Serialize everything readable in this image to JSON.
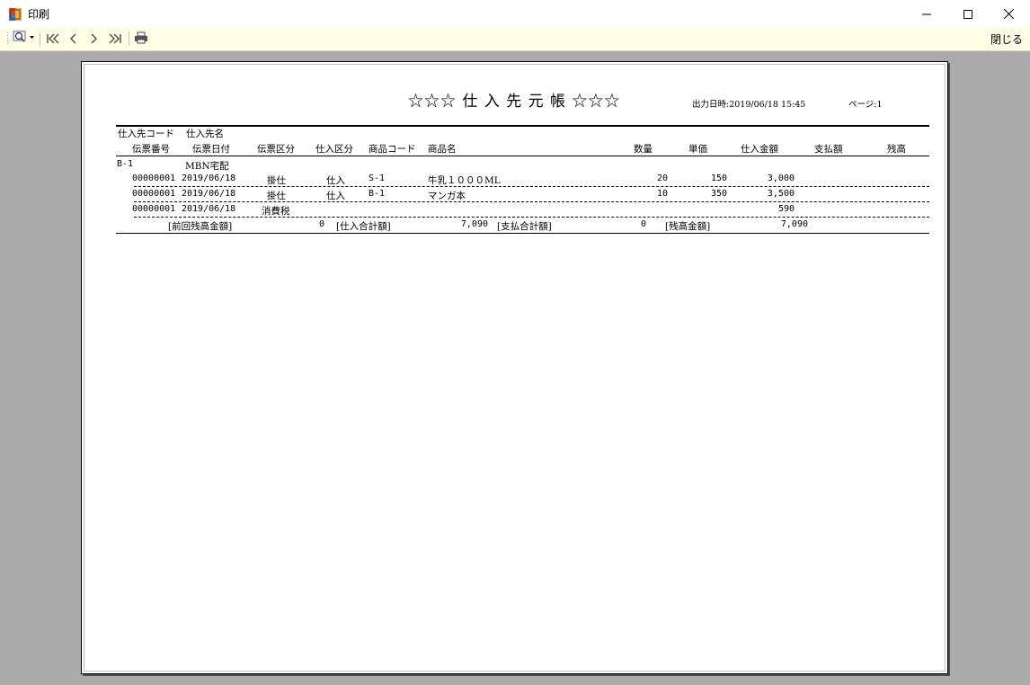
{
  "window": {
    "title": "印刷",
    "minimize_icon": "minimize-icon",
    "maximize_icon": "maximize-icon",
    "close_icon": "close-icon"
  },
  "toolbar": {
    "zoom_icon": "zoom-icon",
    "first_icon": "first-page-icon",
    "prev_icon": "previous-page-icon",
    "next_icon": "next-page-icon",
    "last_icon": "last-page-icon",
    "print_icon": "printer-icon",
    "close_label": "閉じる"
  },
  "report": {
    "title": "☆☆☆ 仕 入 先 元 帳 ☆☆☆",
    "output_datetime": "出力日時:2019/06/18 15:45",
    "page_label": "ページ:1",
    "header1": {
      "supplier_code": "仕入先コード",
      "supplier_name": "仕入先名"
    },
    "header2": {
      "slip_no": "伝票番号",
      "slip_date": "伝票日付",
      "slip_type": "伝票区分",
      "purchase_type": "仕入区分",
      "product_code": "商品コード",
      "product_name": "商品名",
      "quantity": "数量",
      "unit_price": "単価",
      "purchase_amount": "仕入金額",
      "payment_amount": "支払額",
      "balance": "残高"
    },
    "supplier": {
      "code": "B-1",
      "name": "MBN宅配"
    },
    "rows": [
      {
        "slip_no": "00000001",
        "date": "2019/06/18",
        "slip_type": "掛仕",
        "purchase_type": "仕入",
        "product_code": "S-1",
        "product_name": "牛乳１０００ML",
        "qty": "20",
        "price": "150",
        "amount": "3,000"
      },
      {
        "slip_no": "00000001",
        "date": "2019/06/18",
        "slip_type": "掛仕",
        "purchase_type": "仕入",
        "product_code": "B-1",
        "product_name": "マンガ本",
        "qty": "10",
        "price": "350",
        "amount": "3,500"
      },
      {
        "slip_no": "00000001",
        "date": "2019/06/18",
        "slip_type": "消費税",
        "purchase_type": "",
        "product_code": "",
        "product_name": "",
        "qty": "",
        "price": "",
        "amount": "590"
      }
    ],
    "totals": {
      "prev_balance_label": "[前回残高金額]",
      "prev_balance": "0",
      "purchase_total_label": "[仕入合計額]",
      "purchase_total": "7,090",
      "payment_total_label": "[支払合計額]",
      "payment_total": "0",
      "balance_label": "[残高金額]",
      "balance": "7,090"
    }
  }
}
